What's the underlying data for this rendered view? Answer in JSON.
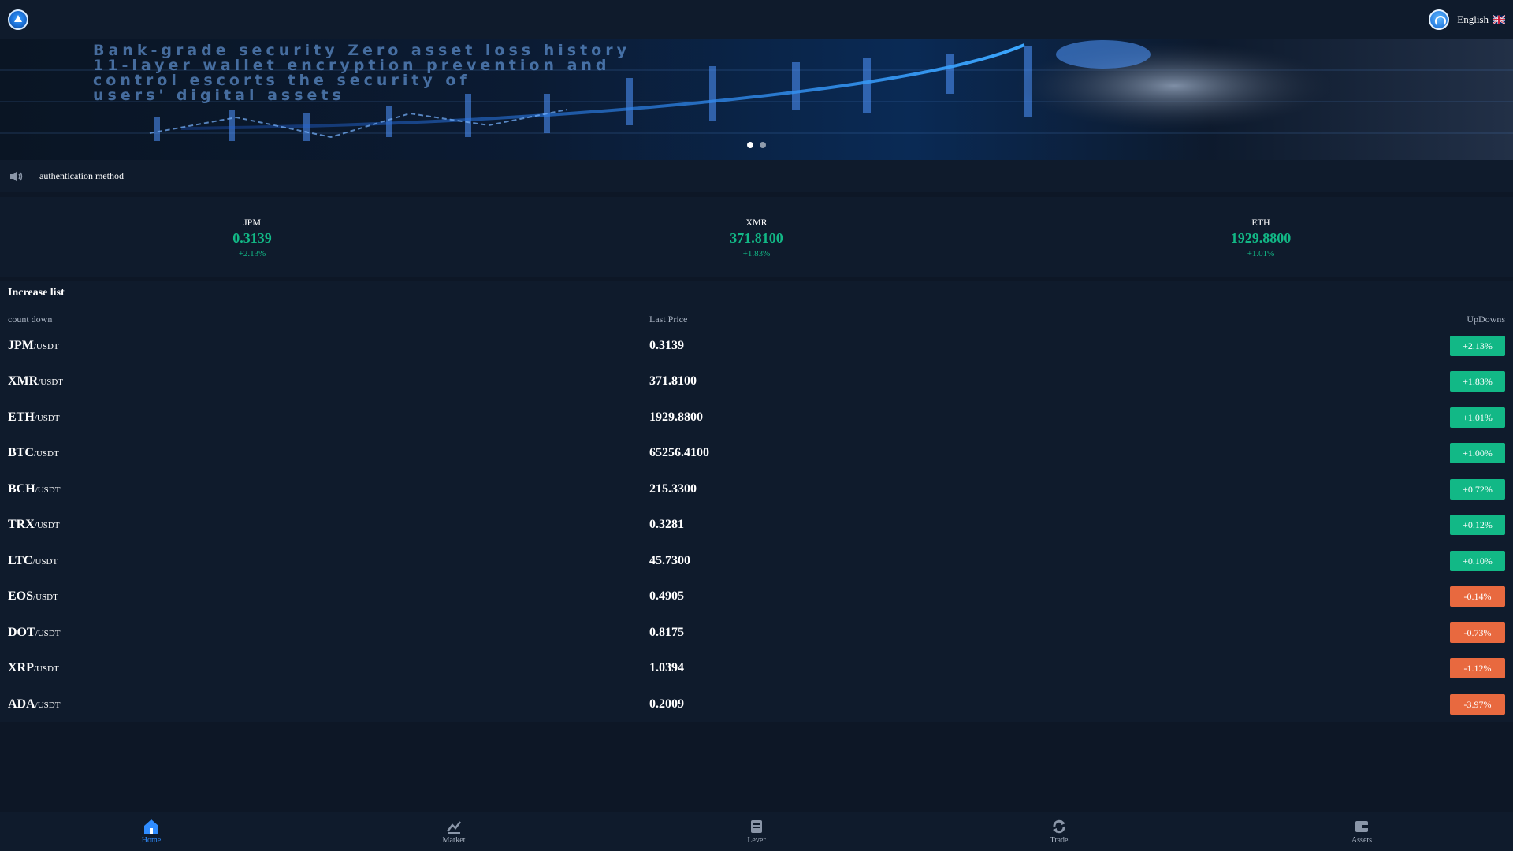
{
  "header": {
    "logo_icon": "exchange-logo-icon",
    "support_icon": "customer-service-icon",
    "language_label": "English",
    "flag_icon": "uk-flag-icon"
  },
  "banner": {
    "lines": [
      "Bank-grade security Zero asset loss history",
      "11-layer wallet encryption prevention and",
      "control escorts the security of",
      "users' digital assets"
    ],
    "slide_count": 2,
    "active_slide": 1
  },
  "notice": {
    "icon": "speaker-icon",
    "text": "authentication method"
  },
  "tickers": [
    {
      "symbol": "JPM",
      "price": "0.3139",
      "change": "+2.13%"
    },
    {
      "symbol": "XMR",
      "price": "371.8100",
      "change": "+1.83%"
    },
    {
      "symbol": "ETH",
      "price": "1929.8800",
      "change": "+1.01%"
    }
  ],
  "list": {
    "title": "Increase list",
    "headers": {
      "name": "count down",
      "price": "Last Price",
      "change": "UpDowns"
    },
    "rows": [
      {
        "base": "JPM",
        "quote": "/USDT",
        "price": "0.3139",
        "change": "+2.13%",
        "dir": "up"
      },
      {
        "base": "XMR",
        "quote": "/USDT",
        "price": "371.8100",
        "change": "+1.83%",
        "dir": "up"
      },
      {
        "base": "ETH",
        "quote": "/USDT",
        "price": "1929.8800",
        "change": "+1.01%",
        "dir": "up"
      },
      {
        "base": "BTC",
        "quote": "/USDT",
        "price": "65256.4100",
        "change": "+1.00%",
        "dir": "up"
      },
      {
        "base": "BCH",
        "quote": "/USDT",
        "price": "215.3300",
        "change": "+0.72%",
        "dir": "up"
      },
      {
        "base": "TRX",
        "quote": "/USDT",
        "price": "0.3281",
        "change": "+0.12%",
        "dir": "up"
      },
      {
        "base": "LTC",
        "quote": "/USDT",
        "price": "45.7300",
        "change": "+0.10%",
        "dir": "up"
      },
      {
        "base": "EOS",
        "quote": "/USDT",
        "price": "0.4905",
        "change": "-0.14%",
        "dir": "down"
      },
      {
        "base": "DOT",
        "quote": "/USDT",
        "price": "0.8175",
        "change": "-0.73%",
        "dir": "down"
      },
      {
        "base": "XRP",
        "quote": "/USDT",
        "price": "1.0394",
        "change": "-1.12%",
        "dir": "down"
      },
      {
        "base": "ADA",
        "quote": "/USDT",
        "price": "0.2009",
        "change": "-3.97%",
        "dir": "down"
      }
    ]
  },
  "colors": {
    "up": "#12b886",
    "down": "#e8693f",
    "active_nav": "#2f8cff"
  },
  "nav": [
    {
      "label": "Home",
      "icon": "home-icon",
      "active": true
    },
    {
      "label": "Market",
      "icon": "market-icon",
      "active": false
    },
    {
      "label": "Lever",
      "icon": "lever-icon",
      "active": false
    },
    {
      "label": "Trade",
      "icon": "trade-icon",
      "active": false
    },
    {
      "label": "Assets",
      "icon": "assets-icon",
      "active": false
    }
  ]
}
